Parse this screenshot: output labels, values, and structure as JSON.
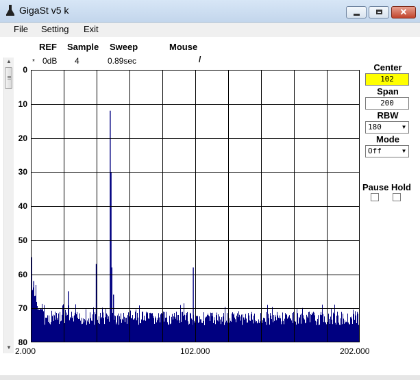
{
  "window": {
    "title": "GigaSt v5 k",
    "icon": "app-icon",
    "controls": {
      "minimize": "minimize-icon",
      "maximize": "maximize-icon",
      "close": "✕"
    }
  },
  "menu": {
    "file": "File",
    "setting": "Setting",
    "exit": "Exit"
  },
  "header": {
    "ref_label": "REF",
    "sample_label": "Sample",
    "sweep_label": "Sweep",
    "mouse_label": "Mouse",
    "marker": "*",
    "ref_value": "0dB",
    "sample_value": "4",
    "sweep_value": "0.89sec",
    "mouse_value": "/"
  },
  "panel": {
    "center_label": "Center",
    "center_value": "102",
    "span_label": "Span",
    "span_value": "200",
    "rbw_label": "RBW",
    "rbw_value": "180",
    "mode_label": "Mode",
    "mode_value": "Off",
    "pause_label": "Pause",
    "hold_label": "Hold",
    "highlight_color": "#ffff00"
  },
  "chart_data": {
    "type": "bar",
    "x_ticks": [
      "2.000",
      "102.000",
      "202.000"
    ],
    "y_ticks": [
      "0",
      "10",
      "20",
      "30",
      "40",
      "50",
      "60",
      "70",
      "80"
    ],
    "xlim": [
      2,
      202
    ],
    "ylim": [
      0,
      80
    ],
    "y_inverted": true,
    "grid": true,
    "series_color": "#000080",
    "noise_floor": 73,
    "peaks": [
      {
        "x": 2.2,
        "y": 55
      },
      {
        "x": 3.5,
        "y": 62
      },
      {
        "x": 24.5,
        "y": 65
      },
      {
        "x": 41.5,
        "y": 57
      },
      {
        "x": 50.0,
        "y": 12
      },
      {
        "x": 50.5,
        "y": 30
      },
      {
        "x": 51.0,
        "y": 58
      },
      {
        "x": 52.0,
        "y": 66
      },
      {
        "x": 100.5,
        "y": 58
      }
    ]
  }
}
